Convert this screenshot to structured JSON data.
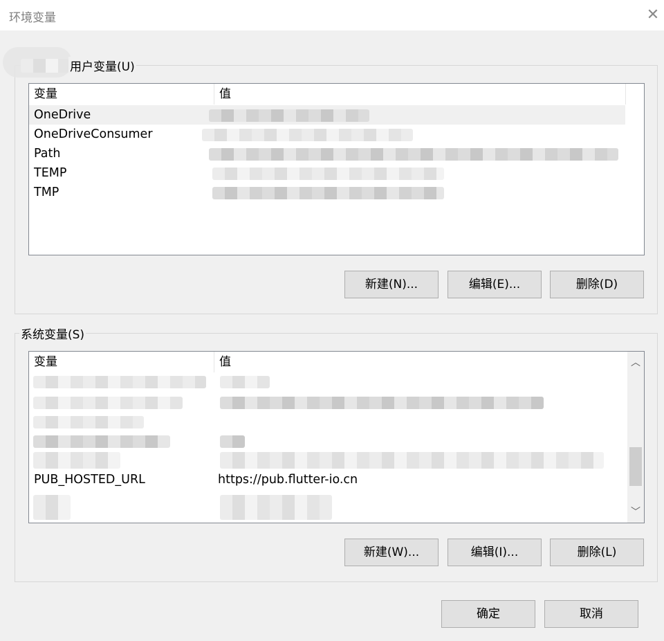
{
  "window": {
    "title": "环境变量",
    "close_icon": "close-icon"
  },
  "user_vars": {
    "group_label": "用户变量(U)",
    "col_name": "变量",
    "col_value": "值",
    "rows": [
      {
        "name": "OneDrive"
      },
      {
        "name": "OneDriveConsumer"
      },
      {
        "name": "Path"
      },
      {
        "name": "TEMP"
      },
      {
        "name": "TMP"
      }
    ],
    "buttons": {
      "new": "新建(N)...",
      "edit": "编辑(E)...",
      "delete": "删除(D)"
    }
  },
  "system_vars": {
    "group_label": "系统变量(S)",
    "col_name": "变量",
    "col_value": "值",
    "visible_row": {
      "name": "PUB_HOSTED_URL",
      "value": "https://pub.flutter-io.cn"
    },
    "buttons": {
      "new": "新建(W)...",
      "edit": "编辑(I)...",
      "delete": "删除(L)"
    }
  },
  "footer": {
    "ok": "确定",
    "cancel": "取消"
  }
}
